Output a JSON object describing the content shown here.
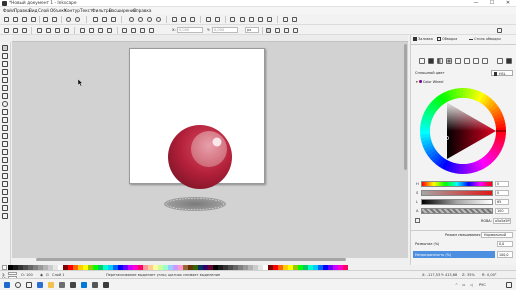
{
  "window": {
    "title": "*Новый документ 1 - Inkscape",
    "minimize": "—",
    "maximize": "☐",
    "close": "✕"
  },
  "menu": {
    "items": [
      "Файл",
      "Правка",
      "Вид",
      "Слой",
      "Объект",
      "Контур",
      "Текст",
      "Фильтры",
      "Расширения",
      "Справка"
    ]
  },
  "tool_controls": {
    "x_label": "X:",
    "x_value": "0,000",
    "y_label": "Y:",
    "y_value": "0,000",
    "w_label": "Ш:",
    "units": "px"
  },
  "panel": {
    "tabs": [
      "Заливка",
      "Обводка",
      "Стиль обводки"
    ],
    "flat_color_label": "Сплошной цвет",
    "color_title": "Color Wheel",
    "mode": "HSL",
    "sliders": [
      {
        "label": "H",
        "value": "0"
      },
      {
        "label": "S",
        "value": "0"
      },
      {
        "label": "L",
        "value": "65"
      },
      {
        "label": "A",
        "value": "100"
      }
    ],
    "rgba_label": "RGBA:",
    "rgba_value": "a5a5a5ff",
    "blend_label": "Режим смешивания",
    "blend_value": "Нормальный",
    "blur_label": "Размытие (%)",
    "blur_value": "0,0",
    "opacity_label": "Непрозрачность (%)",
    "opacity_value": "100,0"
  },
  "status": {
    "fill_label": "З:",
    "stroke_label": "О:",
    "opacity_label": "O:",
    "opacity_value": "100",
    "layer": "Слой 1",
    "message": "Перетаскивание выделяет узлы; щелчок снимает выделение",
    "x_coord": "X: -117,53",
    "y_coord": "Y: 413,68",
    "zoom_label": "Z:",
    "zoom_value": "35%",
    "rotation_label": "R:",
    "rotation_value": "0,00°"
  },
  "taskbar": {
    "keyboard_layout": "РУС"
  },
  "colors": {
    "sphere_dark": "#8e1a2c",
    "sphere_mid": "#b3203a",
    "sphere_highlight": "#d97a86",
    "shadow": "#8a8a8a",
    "canvas_bg": "#d2d2d2",
    "opacity_bar": "#4c8fe0"
  }
}
